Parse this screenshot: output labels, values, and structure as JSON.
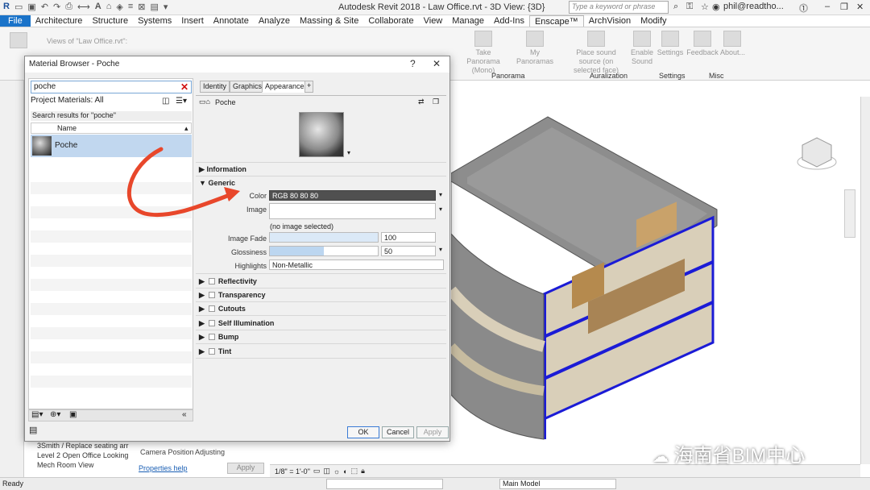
{
  "app": {
    "title": "Autodesk Revit 2018 -    Law Office.rvt - 3D View: {3D}",
    "search_placeholder": "Type a keyword or phrase",
    "user": "phil@readtho..."
  },
  "menu": [
    "File",
    "Architecture",
    "Structure",
    "Systems",
    "Insert",
    "Annotate",
    "Analyze",
    "Massing & Site",
    "Collaborate",
    "View",
    "Manage",
    "Add-Ins",
    "Enscape™",
    "ArchVision",
    "Modify"
  ],
  "ribbon": {
    "views_label": "Views of \"Law Office.rvt\":",
    "buttons": [
      {
        "label": "Take Panorama (Mono)"
      },
      {
        "label": "My Panoramas"
      },
      {
        "label": "Place sound source (on selected face)"
      },
      {
        "label": "Enable Sound"
      },
      {
        "label": "Settings"
      },
      {
        "label": "Feedback"
      },
      {
        "label": "About..."
      }
    ],
    "groups": [
      "Panorama",
      "Auralization",
      "Settings",
      "Misc"
    ]
  },
  "dialog": {
    "title": "Material Browser - Poche",
    "help": "?",
    "close": "✕",
    "search_value": "poche",
    "project_materials": "Project Materials: All",
    "results_label": "Search results for \"poche\"",
    "col_name": "Name",
    "material": "Poche",
    "tabs": [
      "Identity",
      "Graphics",
      "Appearance",
      "+"
    ],
    "asset_name": "Poche",
    "sections": {
      "information": "Information",
      "generic": "Generic",
      "reflectivity": "Reflectivity",
      "transparency": "Transparency",
      "cutouts": "Cutouts",
      "self_illumination": "Self Illumination",
      "bump": "Bump",
      "tint": "Tint"
    },
    "generic": {
      "color_label": "Color",
      "color_value": "RGB 80 80 80",
      "image_label": "Image",
      "image_note": "(no image selected)",
      "fade_label": "Image Fade",
      "fade_value": "100",
      "gloss_label": "Glossiness",
      "gloss_value": "50",
      "high_label": "Highlights",
      "high_value": "Non-Metallic"
    },
    "buttons": {
      "ok": "OK",
      "cancel": "Cancel",
      "apply": "Apply"
    }
  },
  "project_items": [
    "3Smith / Replace seating arr",
    "Level 2 Open Office Looking",
    "Mech Room View"
  ],
  "properties": {
    "camera_position_label": "Camera Position",
    "camera_position_value": "Adjusting",
    "help_link": "Properties help",
    "apply": "Apply"
  },
  "viewbar": {
    "scale": "1/8\" = 1'-0\""
  },
  "status": {
    "ready": "Ready",
    "model": "Main Model"
  },
  "watermark": "海南省BIM中心",
  "colors": {
    "accent": "#1a73c9",
    "selection": "#c1d7ef",
    "red_arrow": "#e8472b",
    "blue_walls": "#1b1bd6"
  }
}
